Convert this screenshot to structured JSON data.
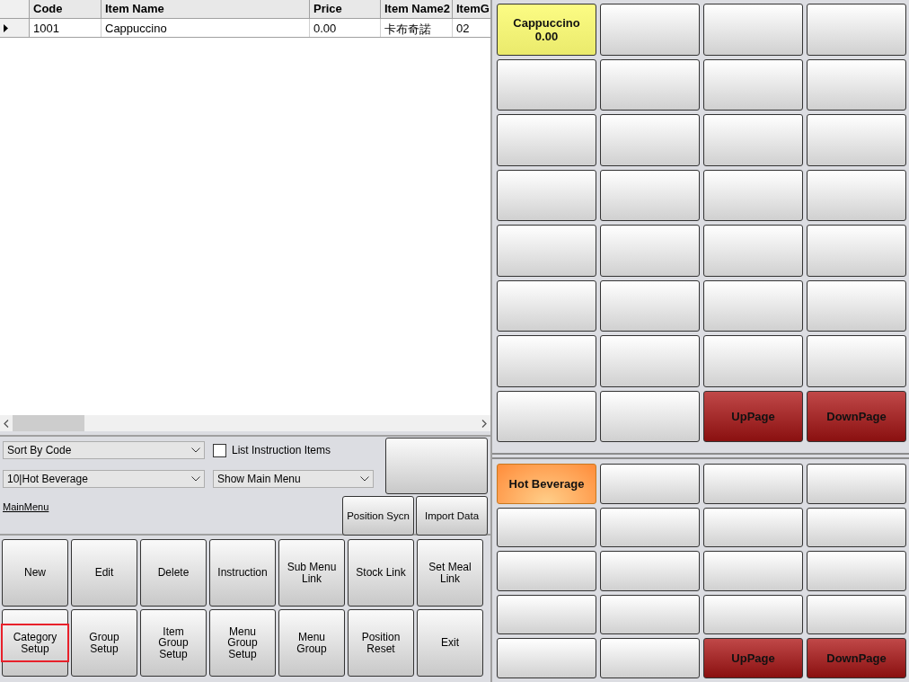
{
  "table": {
    "columns": [
      "Code",
      "Item Name",
      "Price",
      "Item Name2",
      "ItemG"
    ],
    "rows": [
      {
        "selected": true,
        "cells": [
          "1001",
          "Cappuccino",
          "0.00",
          "卡布奇諾",
          "02"
        ]
      }
    ]
  },
  "filters": {
    "sort": "Sort By Code",
    "list_instruction_items": {
      "label": "List Instruction Items",
      "checked": false
    },
    "category": "10|Hot Beverage",
    "menu": "Show Main Menu",
    "link": "MainMenu",
    "buttons": [
      "Position Sycn",
      "Import Data"
    ]
  },
  "actions": [
    {
      "label": "New",
      "highlighted": false
    },
    {
      "label": "Edit",
      "highlighted": false
    },
    {
      "label": "Delete",
      "highlighted": false
    },
    {
      "label": "Instruction",
      "highlighted": false
    },
    {
      "label": "Sub Menu Link",
      "highlighted": false
    },
    {
      "label": "Stock Link",
      "highlighted": false
    },
    {
      "label": "Set Meal Link",
      "highlighted": false
    },
    {
      "label": "Category Setup",
      "highlighted": true
    },
    {
      "label": "Group Setup",
      "highlighted": false
    },
    {
      "label": "Item Group Setup",
      "highlighted": false
    },
    {
      "label": "Menu Group Setup",
      "highlighted": false
    },
    {
      "label": "Menu Group",
      "highlighted": false
    },
    {
      "label": "Position Reset",
      "highlighted": false
    },
    {
      "label": "Exit",
      "highlighted": false
    }
  ],
  "item_buttons": [
    {
      "kind": "item",
      "name": "Cappuccino",
      "price": "0.00"
    },
    {
      "kind": "empty"
    },
    {
      "kind": "empty"
    },
    {
      "kind": "empty"
    },
    {
      "kind": "empty"
    },
    {
      "kind": "empty"
    },
    {
      "kind": "empty"
    },
    {
      "kind": "empty"
    },
    {
      "kind": "empty"
    },
    {
      "kind": "empty"
    },
    {
      "kind": "empty"
    },
    {
      "kind": "empty"
    },
    {
      "kind": "empty"
    },
    {
      "kind": "empty"
    },
    {
      "kind": "empty"
    },
    {
      "kind": "empty"
    },
    {
      "kind": "empty"
    },
    {
      "kind": "empty"
    },
    {
      "kind": "empty"
    },
    {
      "kind": "empty"
    },
    {
      "kind": "empty"
    },
    {
      "kind": "empty"
    },
    {
      "kind": "empty"
    },
    {
      "kind": "empty"
    },
    {
      "kind": "empty"
    },
    {
      "kind": "empty"
    },
    {
      "kind": "empty"
    },
    {
      "kind": "empty"
    },
    {
      "kind": "empty"
    },
    {
      "kind": "empty"
    },
    {
      "kind": "nav",
      "label": "UpPage"
    },
    {
      "kind": "nav",
      "label": "DownPage"
    }
  ],
  "category_buttons": [
    {
      "kind": "category",
      "label": "Hot Beverage"
    },
    {
      "kind": "empty"
    },
    {
      "kind": "empty"
    },
    {
      "kind": "empty"
    },
    {
      "kind": "empty"
    },
    {
      "kind": "empty"
    },
    {
      "kind": "empty"
    },
    {
      "kind": "empty"
    },
    {
      "kind": "empty"
    },
    {
      "kind": "empty"
    },
    {
      "kind": "empty"
    },
    {
      "kind": "empty"
    },
    {
      "kind": "empty"
    },
    {
      "kind": "empty"
    },
    {
      "kind": "empty"
    },
    {
      "kind": "empty"
    },
    {
      "kind": "empty"
    },
    {
      "kind": "empty"
    },
    {
      "kind": "nav",
      "label": "UpPage"
    },
    {
      "kind": "nav",
      "label": "DownPage"
    }
  ]
}
